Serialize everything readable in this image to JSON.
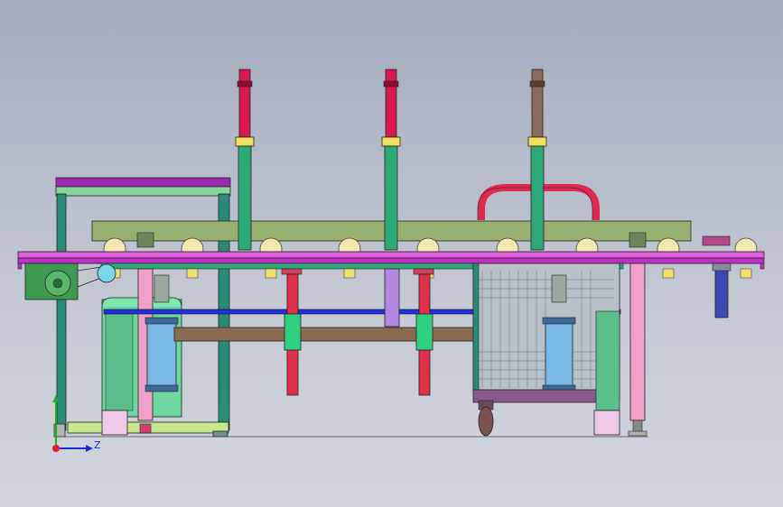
{
  "view": {
    "background_top": "#a3abbd",
    "background_bottom": "#d3d6dd"
  },
  "triad": {
    "z_label": "Z",
    "y_label": "Y",
    "z_color": "#1d2bd6",
    "y_color": "#16b020",
    "origin_color": "#e0202a"
  },
  "colors": {
    "frame_green": "#7fd6a8",
    "frame_teal": "#2c8a78",
    "conveyor_magenta": "#c828c8",
    "plate_olive": "#98b070",
    "column_green": "#2fa878",
    "rod_crimson": "#d81850",
    "rod_red": "#e0304a",
    "hoop_red": "#e02850",
    "cylinder_blue": "#7ab8e6",
    "bar_blue": "#2030e0",
    "beam_brown": "#8a6a50",
    "post_pink": "#f0a0c8",
    "lavender": "#b088e0",
    "roller_cream": "#f4e7b0",
    "mesh_gray": "#8e9aa8",
    "motor_green": "#3e9a50"
  },
  "components": {
    "lifting_columns": 3,
    "lower_cylinders": 2,
    "conveyor_rollers": 9,
    "caster_wheel": 1
  }
}
